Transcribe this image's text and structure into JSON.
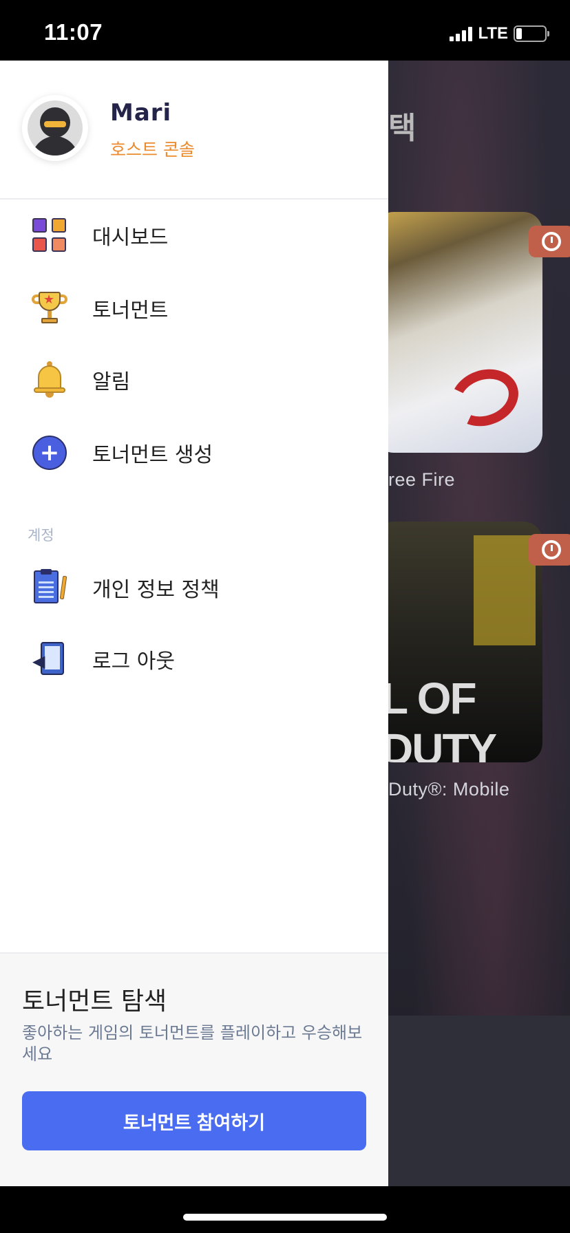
{
  "status_bar": {
    "time": "11:07",
    "network": "LTE",
    "battery_level": 0.2
  },
  "profile": {
    "name": "Mari",
    "role": "호스트 콘솔",
    "role_color": "#ec8a2c",
    "avatar_icon": "ninja-avatar-icon"
  },
  "menu": {
    "items": [
      {
        "label": "대시보드",
        "icon": "dashboard-icon"
      },
      {
        "label": "토너먼트",
        "icon": "trophy-icon"
      },
      {
        "label": "알림",
        "icon": "bell-icon"
      },
      {
        "label": "토너먼트 생성",
        "icon": "plus-circle-icon"
      }
    ],
    "section_account": "계정",
    "account_items": [
      {
        "label": "개인 정보 정책",
        "icon": "document-icon"
      },
      {
        "label": "로그 아웃",
        "icon": "logout-icon"
      }
    ]
  },
  "promo": {
    "title": "토너먼트 탐색",
    "description": "좋아하는 게임의 토너먼트를 플레이하고 우승해보세요",
    "button_label": "토너먼트 참여하기",
    "button_color": "#4a6cf0"
  },
  "background_app": {
    "heading_fragment": "택",
    "cards": [
      {
        "caption": "ree Fire",
        "logo_text": ""
      },
      {
        "caption": "Duty®: Mobile",
        "logo_text": "L OF DUTY"
      }
    ]
  }
}
